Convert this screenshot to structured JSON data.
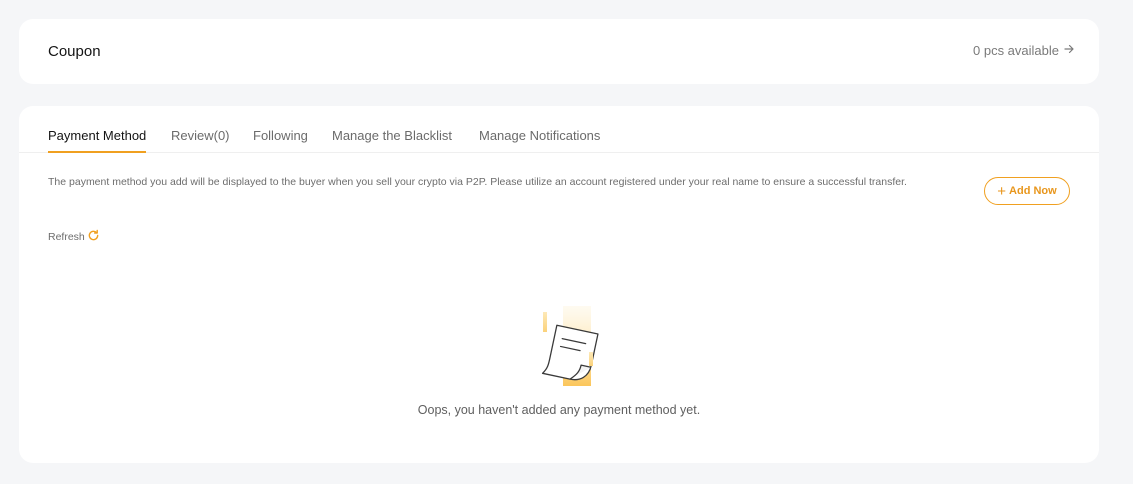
{
  "coupon": {
    "title": "Coupon",
    "available": "0 pcs available"
  },
  "tabs": [
    {
      "label": "Payment Method",
      "active": true
    },
    {
      "label": "Review(0)",
      "active": false
    },
    {
      "label": "Following",
      "active": false
    },
    {
      "label": "Manage the Blacklist",
      "active": false
    },
    {
      "label": "Manage Notifications",
      "active": false
    }
  ],
  "payment": {
    "notice": "The payment method you add will be displayed to the buyer when you sell your crypto via P2P. Please utilize an account registered under your real name to ensure a successful transfer.",
    "add_label": "Add Now",
    "refresh_label": "Refresh",
    "empty_message": "Oops, you haven't added any payment method yet."
  },
  "colors": {
    "accent": "#f0a020",
    "background": "#f5f6f8",
    "card": "#ffffff"
  },
  "icons": {
    "coupon_link": "arrow-right-icon",
    "add": "plus-icon",
    "refresh": "refresh-icon",
    "empty": "empty-document-icon"
  }
}
